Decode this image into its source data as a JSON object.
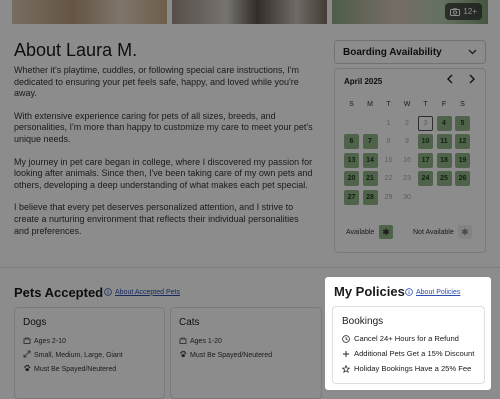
{
  "photos": {
    "badge_count": "12+",
    "badge_icon": "camera-icon"
  },
  "about": {
    "title": "About Laura M.",
    "paragraphs": [
      "Whether it's playtime, cuddles, or following special care instructions, I'm dedicated to ensuring your pet feels safe, happy, and loved while you're away.",
      "With extensive experience caring for pets of all sizes, breeds, and personalities, I'm more than happy to customize my care to meet your pet's unique needs.",
      "My journey in pet care began in college, where I discovered my passion for looking after animals. Since then, I've been taking care of my own pets and others, developing a deep understanding of what makes each pet special.",
      "I believe that every pet deserves personalized attention, and I strive to create a nurturing environment that reflects their individual personalities and preferences."
    ]
  },
  "availability": {
    "select_label": "Boarding Availability",
    "month": "April 2025",
    "weekdays": [
      "S",
      "M",
      "T",
      "W",
      "T",
      "F",
      "S"
    ],
    "days": [
      {
        "d": "",
        "s": "empty"
      },
      {
        "d": "",
        "s": "empty"
      },
      {
        "d": "1",
        "s": "past"
      },
      {
        "d": "2",
        "s": "past"
      },
      {
        "d": "3",
        "s": "today"
      },
      {
        "d": "4",
        "s": "available"
      },
      {
        "d": "5",
        "s": "available"
      },
      {
        "d": "6",
        "s": "available"
      },
      {
        "d": "7",
        "s": "available"
      },
      {
        "d": "8",
        "s": "past"
      },
      {
        "d": "9",
        "s": "past"
      },
      {
        "d": "10",
        "s": "available"
      },
      {
        "d": "11",
        "s": "available"
      },
      {
        "d": "12",
        "s": "available"
      },
      {
        "d": "13",
        "s": "available"
      },
      {
        "d": "14",
        "s": "available"
      },
      {
        "d": "15",
        "s": "past"
      },
      {
        "d": "16",
        "s": "past"
      },
      {
        "d": "17",
        "s": "available"
      },
      {
        "d": "18",
        "s": "available"
      },
      {
        "d": "19",
        "s": "available"
      },
      {
        "d": "20",
        "s": "available"
      },
      {
        "d": "21",
        "s": "available"
      },
      {
        "d": "22",
        "s": "past"
      },
      {
        "d": "23",
        "s": "past"
      },
      {
        "d": "24",
        "s": "available"
      },
      {
        "d": "25",
        "s": "available"
      },
      {
        "d": "26",
        "s": "available"
      },
      {
        "d": "27",
        "s": "available"
      },
      {
        "d": "28",
        "s": "available"
      },
      {
        "d": "29",
        "s": "past"
      },
      {
        "d": "30",
        "s": "past"
      }
    ],
    "legend_available": "Available",
    "legend_not_available": "Not Available",
    "colors": {
      "available": "#8fb585",
      "not_available": "#eeeeee"
    }
  },
  "pets": {
    "title": "Pets Accepted",
    "link": "About Accepted Pets",
    "cards": [
      {
        "name": "Dogs",
        "rows": [
          {
            "icon": "age-icon",
            "text": "Ages 2-10"
          },
          {
            "icon": "size-icon",
            "text": "Small, Medium, Large, Giant"
          },
          {
            "icon": "paw-icon",
            "text": "Must Be Spayed/Neutered"
          }
        ]
      },
      {
        "name": "Cats",
        "rows": [
          {
            "icon": "age-icon",
            "text": "Ages 1-20"
          },
          {
            "icon": "paw-icon",
            "text": "Must Be Spayed/Neutered"
          }
        ]
      }
    ]
  },
  "policies": {
    "title": "My Policies",
    "link": "About Policies",
    "card_title": "Bookings",
    "rows": [
      {
        "icon": "clock-icon",
        "text": "Cancel 24+ Hours for a Refund"
      },
      {
        "icon": "plus-icon",
        "text": "Additional Pets Get a 15% Discount"
      },
      {
        "icon": "star-icon",
        "text": "Holiday Bookings Have a 25% Fee"
      }
    ]
  }
}
